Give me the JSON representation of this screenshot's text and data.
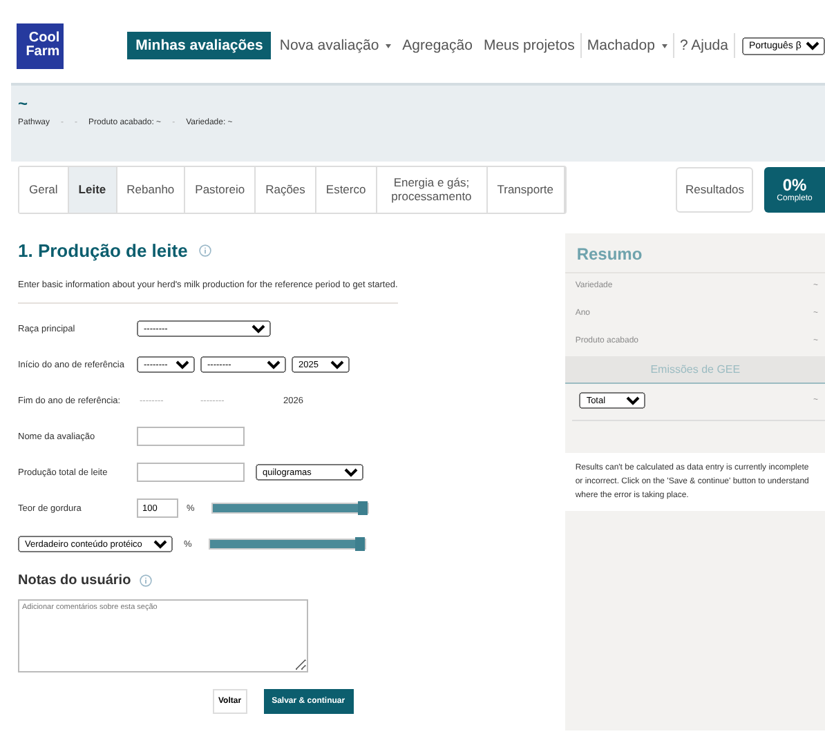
{
  "logo": {
    "line_1": "Cool",
    "line_2": "Farm"
  },
  "nav": [
    {
      "label": "Minhas avaliações",
      "selected": true,
      "caret": false,
      "divider": false
    },
    {
      "label": "Nova avaliação",
      "selected": false,
      "caret": true,
      "divider": false
    },
    {
      "label": "Agregação",
      "selected": false,
      "caret": false,
      "divider": false
    },
    {
      "label": "Meus projetos",
      "selected": false,
      "caret": false,
      "divider": true
    },
    {
      "label": "Machadop",
      "selected": false,
      "caret": true,
      "divider": true
    },
    {
      "label": "? Ajuda",
      "selected": false,
      "caret": false,
      "divider": true
    }
  ],
  "language": "Português β",
  "banner": {
    "title": "~",
    "breadcrumb": [
      {
        "kind": "item",
        "text": "Pathway"
      },
      {
        "kind": "separator",
        "text": "-"
      },
      {
        "kind": "separator",
        "text": "-"
      },
      {
        "kind": "item",
        "text": "Produto acabado: ~"
      },
      {
        "kind": "separator",
        "text": "-"
      },
      {
        "kind": "item",
        "text": "Variedade: ~"
      }
    ]
  },
  "tabs": [
    {
      "label": "Geral",
      "selected": false
    },
    {
      "label": "Leite",
      "selected": true
    },
    {
      "label": "Rebanho",
      "selected": false
    },
    {
      "label": "Pastoreio",
      "selected": false
    },
    {
      "label": "Rações",
      "selected": false
    },
    {
      "label": "Esterco",
      "selected": false
    },
    {
      "label": "Energia e gás; processamento",
      "selected": false
    },
    {
      "label": "Transporte",
      "selected": false
    }
  ],
  "results_button": "Resultados",
  "progress": {
    "value": "0%",
    "label": "Completo"
  },
  "section": {
    "title": "1. Produção de leite",
    "intro": "Enter basic information about your herd's milk production for the reference period to get started."
  },
  "fields": [
    {
      "kind": "select",
      "label": "Raça principal",
      "value": "--------"
    },
    {
      "kind": "date",
      "label": "Início do ano de referência",
      "values": [
        "--------",
        "--------",
        "2025"
      ]
    },
    {
      "kind": "static",
      "label": "Fim do ano de referência:",
      "values": [
        "--------",
        "--------",
        "2026"
      ]
    },
    {
      "kind": "text",
      "label": "Nome da avaliação"
    },
    {
      "kind": "amount",
      "label": "Produção total de leite",
      "unit": "quilogramas"
    },
    {
      "kind": "slider",
      "label": "Teor de gordura",
      "value": "100",
      "unit": "%",
      "level": 1
    },
    {
      "kind": "slider-select",
      "label": "Verdadeiro conteúdo protéico",
      "unit": "%",
      "level": 1
    }
  ],
  "notes": {
    "title": "Notas do usuário",
    "placeholder": "Adicionar comentários sobre esta seção"
  },
  "buttons": {
    "back": "Voltar",
    "save": "Salvar & continuar"
  },
  "summary": {
    "title": "Resumo",
    "rows": [
      {
        "label": "Variedade",
        "value": "~"
      },
      {
        "label": "Ano",
        "value": "~"
      },
      {
        "label": "Produto acabado",
        "value": "~"
      }
    ],
    "emissions": "Emissões de GEE",
    "filter": "Total",
    "filter_value": "~",
    "message": "Results can't be calculated as data entry is currently incomplete or incorrect. Click on the 'Save & continue' button to understand where the error is taking place."
  }
}
